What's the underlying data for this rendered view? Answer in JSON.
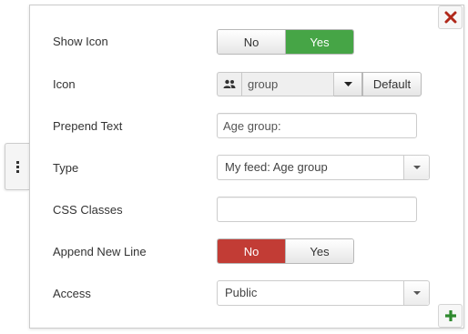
{
  "fields": {
    "show_icon": {
      "label": "Show Icon",
      "options": [
        "No",
        "Yes"
      ],
      "selected": "Yes"
    },
    "icon": {
      "label": "Icon",
      "icon_name": "users-icon",
      "value": "group",
      "default_label": "Default"
    },
    "prepend_text": {
      "label": "Prepend Text",
      "value": "Age group:"
    },
    "type": {
      "label": "Type",
      "selected": "My feed: Age group"
    },
    "css_classes": {
      "label": "CSS Classes",
      "value": ""
    },
    "append_new_line": {
      "label": "Append New Line",
      "options": [
        "No",
        "Yes"
      ],
      "selected": "No"
    },
    "access": {
      "label": "Access",
      "selected": "Public"
    }
  },
  "controls": {
    "close_icon": "close-icon",
    "add_icon": "plus-icon",
    "handle_icon": "vertical-dots-icon"
  },
  "colors": {
    "yes_active": "#46a546",
    "no_active": "#c23c35",
    "close": "#b0281a",
    "add": "#2f8a2f"
  }
}
